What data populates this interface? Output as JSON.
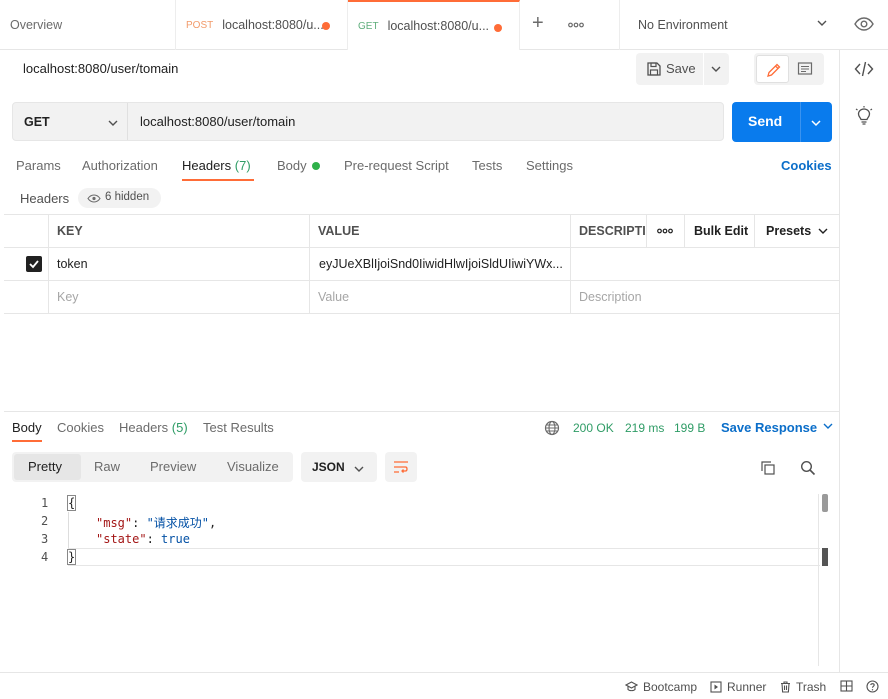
{
  "tabs": {
    "overview": "Overview",
    "items": [
      {
        "method": "POST",
        "title": "localhost:8080/u..."
      },
      {
        "method": "GET",
        "title": "localhost:8080/u..."
      }
    ],
    "more": "ooo"
  },
  "environment": {
    "selected": "No Environment"
  },
  "request": {
    "title": "localhost:8080/user/tomain",
    "save_label": "Save",
    "method": "GET",
    "url": "localhost:8080/user/tomain",
    "send_label": "Send"
  },
  "request_tabs": {
    "params": "Params",
    "authorization": "Authorization",
    "headers": "Headers",
    "headers_count": "(7)",
    "body": "Body",
    "pre_request": "Pre-request Script",
    "tests": "Tests",
    "settings": "Settings",
    "cookies": "Cookies"
  },
  "headers_section": {
    "label": "Headers",
    "hidden": "6 hidden",
    "columns": {
      "key": "KEY",
      "value": "VALUE",
      "description": "DESCRIPTIO"
    },
    "more": "ooo",
    "bulk_edit": "Bulk Edit",
    "presets": "Presets",
    "rows": [
      {
        "key": "token",
        "value": "eyJUeXBlIjoiSnd0IiwidHlwIjoiSldUIiwiYWx...",
        "description": "",
        "checked": true
      }
    ],
    "placeholders": {
      "key": "Key",
      "value": "Value",
      "description": "Description"
    }
  },
  "response": {
    "tabs": {
      "body": "Body",
      "cookies": "Cookies",
      "headers": "Headers",
      "headers_count": "(5)",
      "test_results": "Test Results"
    },
    "status": "200 OK",
    "time": "219 ms",
    "size": "199 B",
    "save_response": "Save Response",
    "formats": {
      "pretty": "Pretty",
      "raw": "Raw",
      "preview": "Preview",
      "visualize": "Visualize"
    },
    "language": "JSON",
    "line_numbers": [
      "1",
      "2",
      "3",
      "4"
    ],
    "code": {
      "open": "{",
      "msg_key": "\"msg\"",
      "msg_value": "\"请求成功\"",
      "state_key": "\"state\"",
      "state_value": "true",
      "close": "}"
    }
  },
  "statusbar": {
    "bootcamp": "Bootcamp",
    "runner": "Runner",
    "trash": "Trash"
  },
  "colors": {
    "accent": "#ff6c37",
    "primary": "#097bed",
    "success": "#2f9c66",
    "link": "#0b6ec9"
  }
}
